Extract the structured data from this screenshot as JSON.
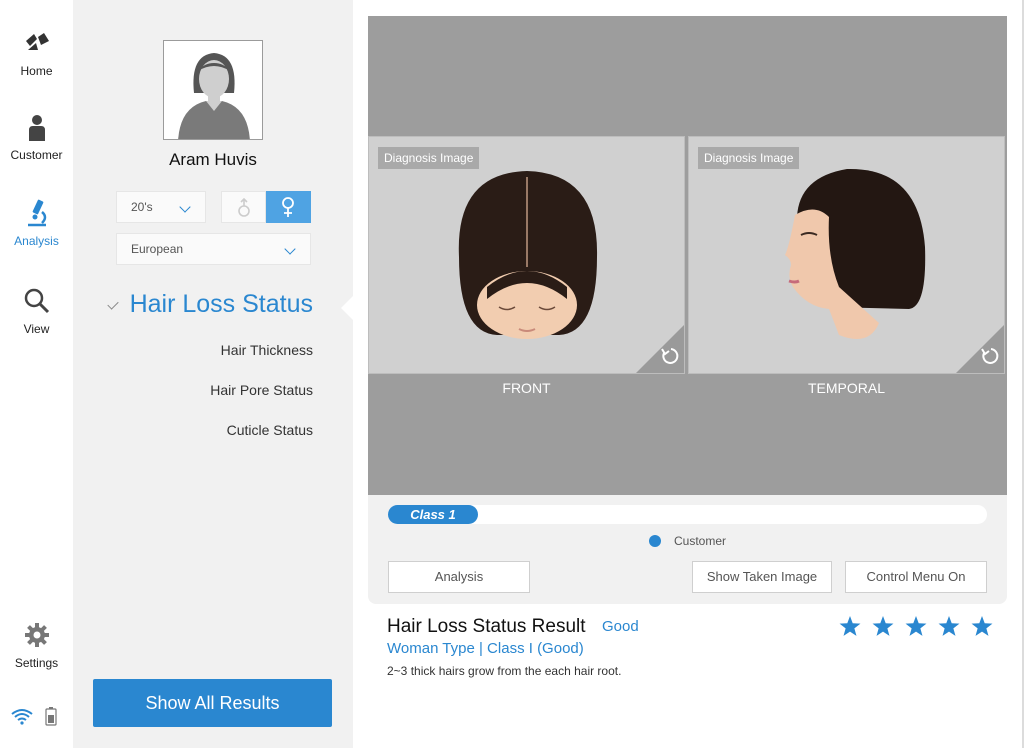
{
  "nav": {
    "home": "Home",
    "customer": "Customer",
    "analysis": "Analysis",
    "view": "View",
    "settings": "Settings",
    "accent_color": "#2a87d0"
  },
  "profile": {
    "name": "Aram Huvis",
    "age": "20's",
    "gender_selected": "female",
    "ethnicity": "European"
  },
  "menu": {
    "main": "Hair Loss Status",
    "items": [
      "Hair Thickness",
      "Hair Pore Status",
      "Cuticle Status"
    ],
    "show_all": "Show All Results"
  },
  "viewer": {
    "front": {
      "tag": "Diagnosis Image",
      "label": "FRONT"
    },
    "temporal": {
      "tag": "Diagnosis Image",
      "label": "TEMPORAL"
    }
  },
  "progress": {
    "label": "Class 1",
    "fraction": 0.15,
    "legend": "Customer"
  },
  "buttons": {
    "analysis": "Analysis",
    "show_taken": "Show Taken Image",
    "control_menu": "Control Menu On"
  },
  "result": {
    "title": "Hair Loss Status Result",
    "grade": "Good",
    "type": "Woman Type | Class I  (Good)",
    "description": "2~3 thick hairs grow from the each hair root.",
    "stars": 5,
    "stars_max": 5
  }
}
